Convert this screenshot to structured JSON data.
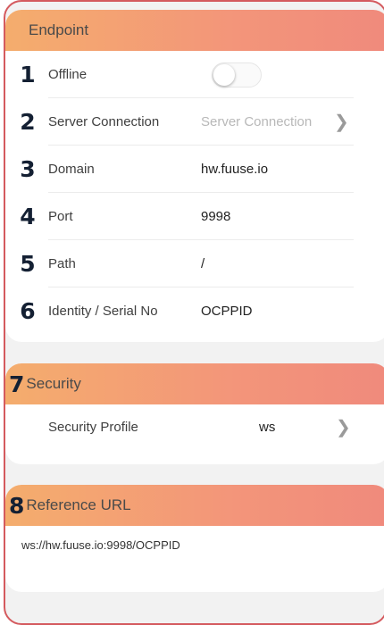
{
  "endpoint": {
    "title": "Endpoint",
    "rows": [
      {
        "num": "1",
        "label": "Offline",
        "type": "toggle",
        "on": false
      },
      {
        "num": "2",
        "label": "Server Connection",
        "value": "Server Connection",
        "type": "select"
      },
      {
        "num": "3",
        "label": "Domain",
        "value": "hw.fuuse.io",
        "type": "text"
      },
      {
        "num": "4",
        "label": "Port",
        "value": "9998",
        "type": "text"
      },
      {
        "num": "5",
        "label": "Path",
        "value": "/",
        "type": "text"
      },
      {
        "num": "6",
        "label": "Identity / Serial No",
        "value": "OCPPID",
        "type": "text"
      }
    ]
  },
  "security": {
    "num": "7",
    "title": "Security",
    "profile_label": "Security Profile",
    "profile_value": "ws"
  },
  "reference": {
    "num": "8",
    "title": "Reference URL",
    "url": "ws://hw.fuuse.io:9998/OCPPID"
  },
  "icons": {
    "chevron": "chevron-right-icon"
  },
  "colors": {
    "header_start": "#f4ad6d",
    "header_end": "#f08a7c",
    "frame_border": "#d45a5e",
    "number": "#142033"
  }
}
